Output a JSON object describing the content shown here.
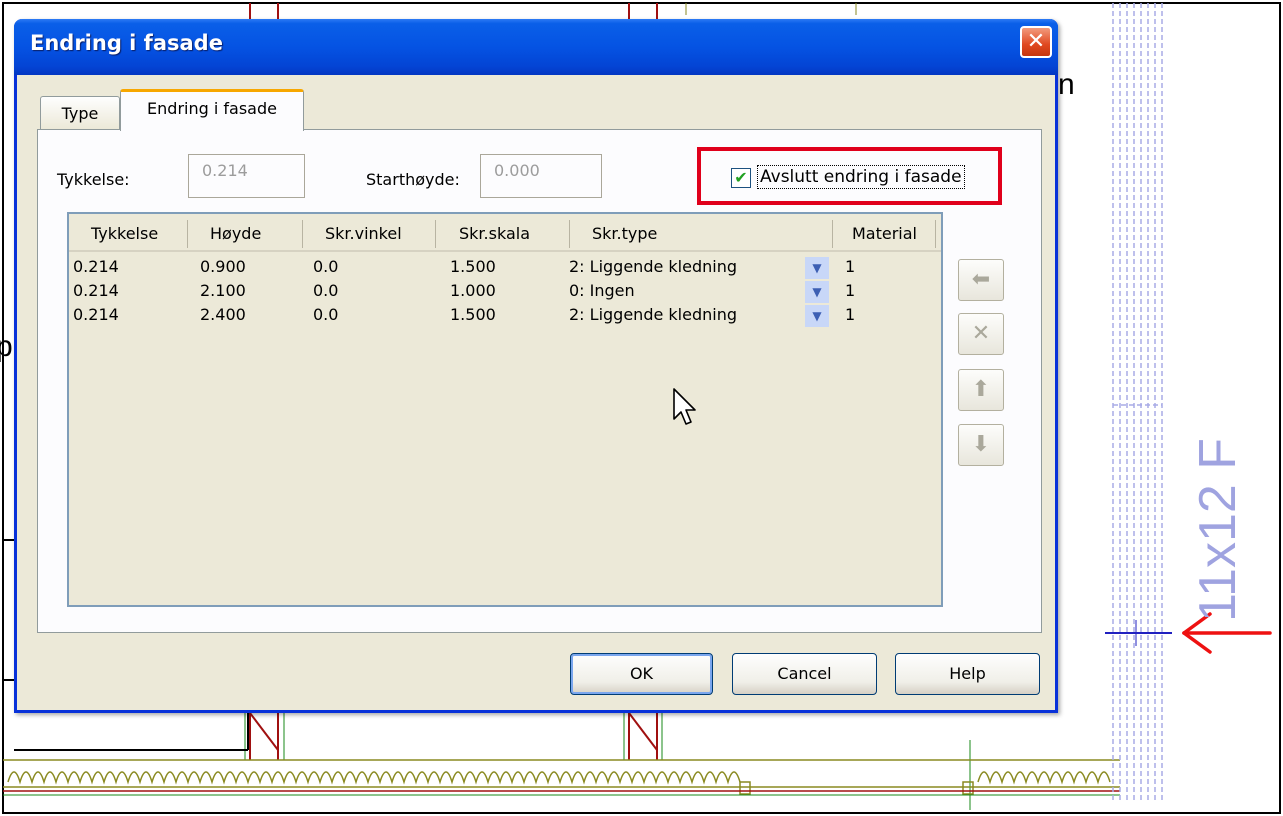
{
  "dialog": {
    "title": "Endring i fasade",
    "close_glyph": "✕"
  },
  "tabs": [
    {
      "label": "Type",
      "active": false
    },
    {
      "label": "Endring i fasade",
      "active": true
    }
  ],
  "fields": {
    "tykkelse_label": "Tykkelse:",
    "tykkelse_value": "0.214",
    "starthoyde_label": "Starthøyde:",
    "starthoyde_value": "0.000"
  },
  "checkbox": {
    "label": "Avslutt endring i fasade",
    "checked": true,
    "check_glyph": "✔"
  },
  "grid": {
    "columns": [
      "Tykkelse",
      "Høyde",
      "Skr.vinkel",
      "Skr.skala",
      "Skr.type",
      "Material"
    ],
    "rows": [
      [
        "0.214",
        "0.900",
        "0.0",
        "1.500",
        "2: Liggende kledning",
        "1"
      ],
      [
        "0.214",
        "2.100",
        "0.0",
        "1.000",
        "0: Ingen",
        "1"
      ],
      [
        "0.214",
        "2.400",
        "0.0",
        "1.500",
        "2: Liggende kledning",
        "1"
      ]
    ],
    "dropdown_glyph": "▼"
  },
  "side_buttons": [
    {
      "name": "move-left-button",
      "icon": "arrow-left-icon",
      "glyph": "⬅"
    },
    {
      "name": "delete-row-button",
      "icon": "delete-icon",
      "glyph": "✕"
    },
    {
      "name": "move-up-button",
      "icon": "arrow-up-icon",
      "glyph": "⬆"
    },
    {
      "name": "move-down-button",
      "icon": "arrow-down-icon",
      "glyph": "⬇"
    }
  ],
  "buttons": {
    "ok": "OK",
    "cancel": "Cancel",
    "help": "Help"
  },
  "background": {
    "vertical_label": "11x12 F",
    "letter_right": "n",
    "letter_left": "p"
  },
  "colors": {
    "titlebar": "#0553e3",
    "highlight": "#e0001b",
    "dialog_bg": "#ece9d8"
  }
}
